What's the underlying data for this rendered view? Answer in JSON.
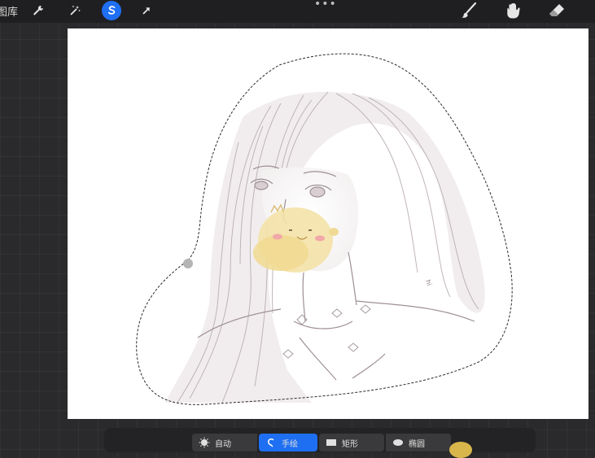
{
  "topbar": {
    "gallery_label": "图库",
    "tools_left": [
      {
        "name": "actions",
        "icon": "wrench-icon"
      },
      {
        "name": "adjustments",
        "icon": "magic-wand-icon"
      },
      {
        "name": "selection",
        "icon": "selection-s-icon",
        "active": true
      },
      {
        "name": "transform",
        "icon": "arrow-cursor-icon"
      }
    ],
    "more": "•••",
    "tools_right": [
      {
        "name": "brush",
        "icon": "brush-icon"
      },
      {
        "name": "smudge",
        "icon": "smudge-icon"
      },
      {
        "name": "eraser",
        "icon": "eraser-icon"
      }
    ]
  },
  "selection_toolbar": {
    "modes": [
      {
        "key": "auto",
        "label": "自动",
        "icon": "sun-burst-icon"
      },
      {
        "key": "free",
        "label": "手绘",
        "icon": "freehand-icon",
        "active": true
      },
      {
        "key": "rect",
        "label": "矩形",
        "icon": "rectangle-icon"
      },
      {
        "key": "ellipse",
        "label": "椭圆",
        "icon": "ellipse-icon"
      }
    ]
  },
  "colors": {
    "accent": "#1e6ff2",
    "toolbar_bg": "#1f1f21"
  }
}
